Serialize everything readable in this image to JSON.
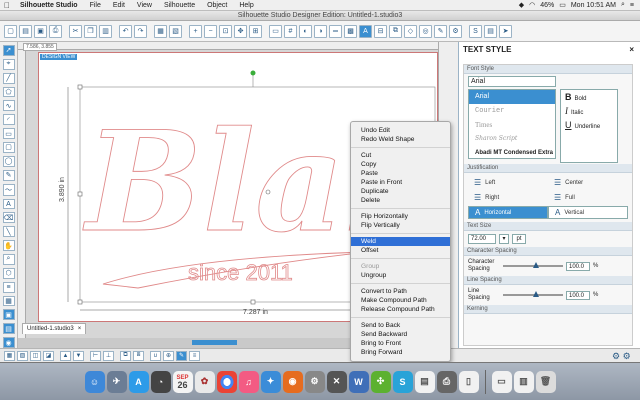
{
  "menubar": {
    "app": "Silhouette Studio",
    "items": [
      "File",
      "Edit",
      "View",
      "Silhouette",
      "Object",
      "Help"
    ],
    "battery": "46%",
    "clock": "Mon 10:51 AM"
  },
  "window": {
    "title": "Silhouette Studio Designer Edition: Untitled-1.studio3"
  },
  "canvas": {
    "coords": "7.586, 3.855",
    "design_view": "DESIGN VIEW",
    "art_main_text": "Blak",
    "art_sub_text": "since 2011",
    "width_label": "7.287 in",
    "height_label": "3.890 in"
  },
  "doc_tab": {
    "label": "Untitled-1.studio3",
    "close": "×"
  },
  "context_menu": {
    "groups": [
      [
        {
          "label": "Undo Edit"
        },
        {
          "label": "Redo Weld Shape"
        }
      ],
      [
        {
          "label": "Cut"
        },
        {
          "label": "Copy"
        },
        {
          "label": "Paste"
        },
        {
          "label": "Paste in Front"
        },
        {
          "label": "Duplicate"
        },
        {
          "label": "Delete"
        }
      ],
      [
        {
          "label": "Flip Horizontally"
        },
        {
          "label": "Flip Vertically"
        }
      ],
      [
        {
          "label": "Weld",
          "highlight": true
        },
        {
          "label": "Offset"
        }
      ],
      [
        {
          "label": "Group",
          "disabled": true
        },
        {
          "label": "Ungroup"
        }
      ],
      [
        {
          "label": "Convert to Path"
        },
        {
          "label": "Make Compound Path"
        },
        {
          "label": "Release Compound Path"
        }
      ],
      [
        {
          "label": "Send to Back"
        },
        {
          "label": "Send Backward"
        },
        {
          "label": "Bring to Front"
        },
        {
          "label": "Bring Forward"
        }
      ]
    ]
  },
  "text_style": {
    "title": "TEXT STYLE",
    "font_style_label": "Font Style",
    "font_value": "Arial",
    "fonts": [
      "Arial",
      "Courier",
      "Times",
      "Sharon Script",
      "Abadi MT Condensed Extra"
    ],
    "styles": {
      "bold_glyph": "B",
      "bold_label": "Bold",
      "italic_glyph": "I",
      "italic_label": "Italic",
      "underline_glyph": "U",
      "underline_label": "Underline"
    },
    "justification_label": "Justification",
    "justify": {
      "left": "Left",
      "center": "Center",
      "right": "Right",
      "full": "Full",
      "horizontal": "Horizontal",
      "vertical": "Vertical"
    },
    "text_size_label": "Text Size",
    "text_size": "72.00",
    "text_size_unit": "pt",
    "char_spacing_section": "Character Spacing",
    "char_spacing_label": "Character Spacing",
    "char_spacing_value": "100.0",
    "line_spacing_section": "Line Spacing",
    "line_spacing_label": "Line Spacing",
    "line_spacing_value": "100.0",
    "percent": "%",
    "kerning_label": "Kerning"
  },
  "colors": {
    "accent": "#3b8fd0",
    "menu_highlight": "#2f6fd6",
    "outline": "#e08a8a"
  },
  "dock": {
    "calendar_month": "SEP",
    "calendar_day": "26"
  }
}
